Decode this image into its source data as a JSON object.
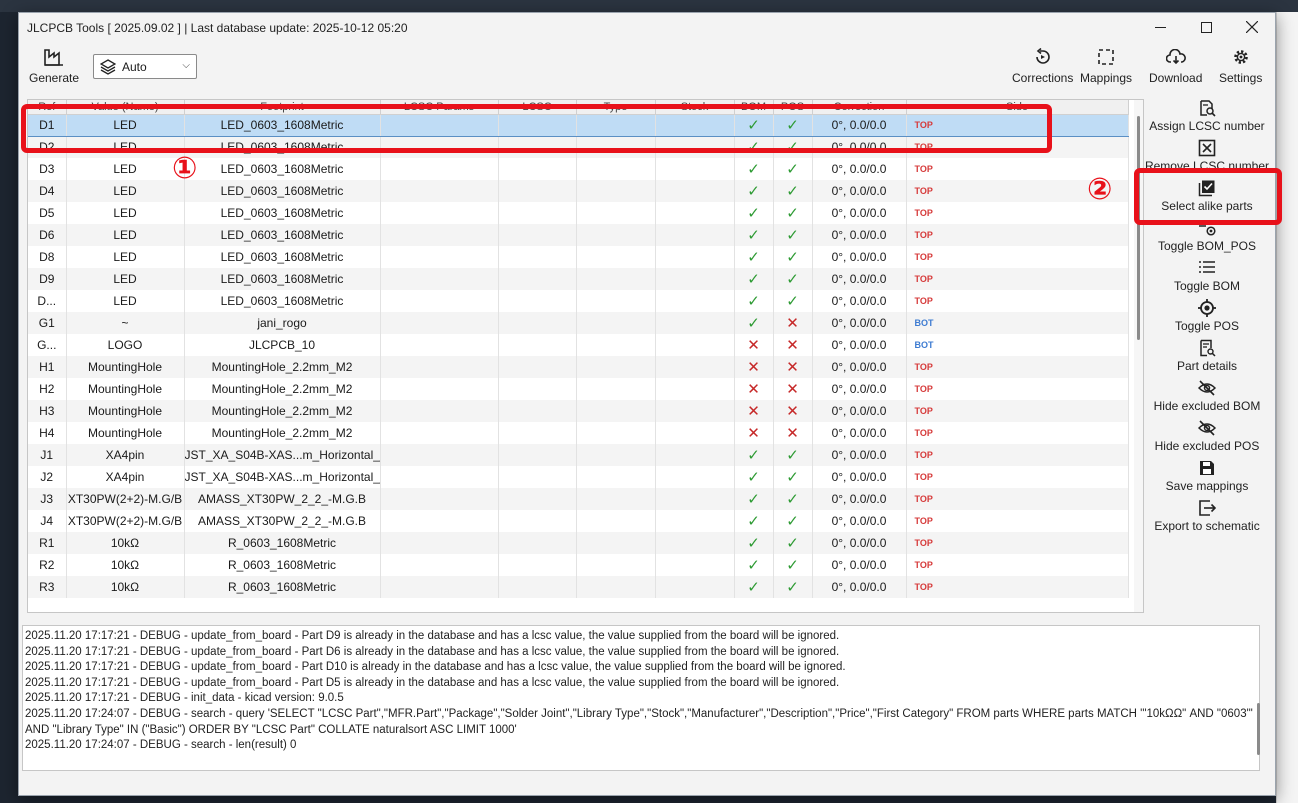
{
  "window": {
    "title": "JLCPCB Tools [ 2025.09.02 ] | Last database update: 2025-10-12 05:20"
  },
  "toolbar": {
    "generate_label": "Generate",
    "layer_select_value": "Auto",
    "corrections_label": "Corrections",
    "mappings_label": "Mappings",
    "download_label": "Download",
    "settings_label": "Settings"
  },
  "table": {
    "headers": [
      "Ref",
      "Value (Name)",
      "Footprint",
      "LCSC Params",
      "LCSC",
      "Type",
      "Stock",
      "BOM",
      "POS",
      "Correction",
      "Side"
    ],
    "rows": [
      {
        "ref": "D1",
        "value": "LED",
        "footprint": "LED_0603_1608Metric",
        "bom": "✓",
        "pos": "✓",
        "correction": "0°, 0.0/0.0",
        "side": "TOP"
      },
      {
        "ref": "D2",
        "value": "LED",
        "footprint": "LED_0603_1608Metric",
        "bom": "✓",
        "pos": "✓",
        "correction": "0°, 0.0/0.0",
        "side": "TOP"
      },
      {
        "ref": "D3",
        "value": "LED",
        "footprint": "LED_0603_1608Metric",
        "bom": "✓",
        "pos": "✓",
        "correction": "0°, 0.0/0.0",
        "side": "TOP"
      },
      {
        "ref": "D4",
        "value": "LED",
        "footprint": "LED_0603_1608Metric",
        "bom": "✓",
        "pos": "✓",
        "correction": "0°, 0.0/0.0",
        "side": "TOP"
      },
      {
        "ref": "D5",
        "value": "LED",
        "footprint": "LED_0603_1608Metric",
        "bom": "✓",
        "pos": "✓",
        "correction": "0°, 0.0/0.0",
        "side": "TOP"
      },
      {
        "ref": "D6",
        "value": "LED",
        "footprint": "LED_0603_1608Metric",
        "bom": "✓",
        "pos": "✓",
        "correction": "0°, 0.0/0.0",
        "side": "TOP"
      },
      {
        "ref": "D8",
        "value": "LED",
        "footprint": "LED_0603_1608Metric",
        "bom": "✓",
        "pos": "✓",
        "correction": "0°, 0.0/0.0",
        "side": "TOP"
      },
      {
        "ref": "D9",
        "value": "LED",
        "footprint": "LED_0603_1608Metric",
        "bom": "✓",
        "pos": "✓",
        "correction": "0°, 0.0/0.0",
        "side": "TOP"
      },
      {
        "ref": "D...",
        "value": "LED",
        "footprint": "LED_0603_1608Metric",
        "bom": "✓",
        "pos": "✓",
        "correction": "0°, 0.0/0.0",
        "side": "TOP"
      },
      {
        "ref": "G1",
        "value": "~",
        "footprint": "jani_rogo",
        "bom": "✓",
        "pos": "✕",
        "correction": "0°, 0.0/0.0",
        "side": "BOT"
      },
      {
        "ref": "G...",
        "value": "LOGO",
        "footprint": "JLCPCB_10",
        "bom": "✕",
        "pos": "✕",
        "correction": "0°, 0.0/0.0",
        "side": "BOT"
      },
      {
        "ref": "H1",
        "value": "MountingHole",
        "footprint": "MountingHole_2.2mm_M2",
        "bom": "✕",
        "pos": "✕",
        "correction": "0°, 0.0/0.0",
        "side": "TOP"
      },
      {
        "ref": "H2",
        "value": "MountingHole",
        "footprint": "MountingHole_2.2mm_M2",
        "bom": "✕",
        "pos": "✕",
        "correction": "0°, 0.0/0.0",
        "side": "TOP"
      },
      {
        "ref": "H3",
        "value": "MountingHole",
        "footprint": "MountingHole_2.2mm_M2",
        "bom": "✕",
        "pos": "✕",
        "correction": "0°, 0.0/0.0",
        "side": "TOP"
      },
      {
        "ref": "H4",
        "value": "MountingHole",
        "footprint": "MountingHole_2.2mm_M2",
        "bom": "✕",
        "pos": "✕",
        "correction": "0°, 0.0/0.0",
        "side": "TOP"
      },
      {
        "ref": "J1",
        "value": "XA4pin",
        "footprint": "JST_XA_S04B-XAS...m_Horizontal__",
        "bom": "✓",
        "pos": "✓",
        "correction": "0°, 0.0/0.0",
        "side": "TOP"
      },
      {
        "ref": "J2",
        "value": "XA4pin",
        "footprint": "JST_XA_S04B-XAS...m_Horizontal__",
        "bom": "✓",
        "pos": "✓",
        "correction": "0°, 0.0/0.0",
        "side": "TOP"
      },
      {
        "ref": "J3",
        "value": "XT30PW(2+2)-M.G/B",
        "footprint": "AMASS_XT30PW_2_2_-M.G.B",
        "bom": "✓",
        "pos": "✓",
        "correction": "0°, 0.0/0.0",
        "side": "TOP"
      },
      {
        "ref": "J4",
        "value": "XT30PW(2+2)-M.G/B",
        "footprint": "AMASS_XT30PW_2_2_-M.G.B",
        "bom": "✓",
        "pos": "✓",
        "correction": "0°, 0.0/0.0",
        "side": "TOP"
      },
      {
        "ref": "R1",
        "value": "10kΩ",
        "footprint": "R_0603_1608Metric",
        "bom": "✓",
        "pos": "✓",
        "correction": "0°, 0.0/0.0",
        "side": "TOP"
      },
      {
        "ref": "R2",
        "value": "10kΩ",
        "footprint": "R_0603_1608Metric",
        "bom": "✓",
        "pos": "✓",
        "correction": "0°, 0.0/0.0",
        "side": "TOP"
      },
      {
        "ref": "R3",
        "value": "10kΩ",
        "footprint": "R_0603_1608Metric",
        "bom": "✓",
        "pos": "✓",
        "correction": "0°, 0.0/0.0",
        "side": "TOP"
      }
    ]
  },
  "actions": [
    {
      "label": "Assign LCSC number",
      "icon": "search-doc-icon"
    },
    {
      "label": "Remove LCSC number",
      "icon": "x-box-icon"
    },
    {
      "label": "Select alike parts",
      "icon": "checkbox-stack-icon"
    },
    {
      "label": "Toggle BOM_POS",
      "icon": "list-target-icon"
    },
    {
      "label": "Toggle BOM",
      "icon": "list-icon"
    },
    {
      "label": "Toggle POS",
      "icon": "target-icon"
    },
    {
      "label": "Part details",
      "icon": "doc-search-icon"
    },
    {
      "label": "Hide excluded BOM",
      "icon": "eye-slash-icon"
    },
    {
      "label": "Hide excluded POS",
      "icon": "eye-slash-icon"
    },
    {
      "label": "Save mappings",
      "icon": "floppy-icon"
    },
    {
      "label": "Export to schematic",
      "icon": "export-icon"
    }
  ],
  "log": [
    "2025.11.20 17:17:21 - DEBUG - update_from_board -  Part D9 is already in the database and has a lcsc value, the value supplied from the board will be ignored.",
    "2025.11.20 17:17:21 - DEBUG - update_from_board -  Part D6 is already in the database and has a lcsc value, the value supplied from the board will be ignored.",
    "2025.11.20 17:17:21 - DEBUG - update_from_board -  Part D10 is already in the database and has a lcsc value, the value supplied from the board will be ignored.",
    "2025.11.20 17:17:21 - DEBUG - update_from_board -  Part D5 is already in the database and has a lcsc value, the value supplied from the board will be ignored.",
    "2025.11.20 17:17:21 - DEBUG - init_data -  kicad version: 9.0.5",
    "2025.11.20 17:24:07 - DEBUG - search -  query 'SELECT \"LCSC Part\",\"MFR.Part\",\"Package\",\"Solder Joint\",\"Library Type\",\"Stock\",\"Manufacturer\",\"Description\",\"Price\",\"First Category\" FROM parts WHERE parts MATCH '\"10kΩΩ\" AND \"0603\"'",
    "AND \"Library Type\" IN (\"Basic\") ORDER BY \"LCSC Part\" COLLATE naturalsort ASC LIMIT 1000'",
    "2025.11.20 17:24:07 - DEBUG - search -  len(result) 0"
  ],
  "annotations": {
    "marker1": "①",
    "marker2": "②"
  },
  "colors": {
    "annotation_red": "#e8111a",
    "selected_row": "#bfdcf5",
    "ok_green": "#2e9b34",
    "ng_red": "#c62828",
    "side_top": "#d63a3a",
    "side_bot": "#3d7bd1"
  }
}
